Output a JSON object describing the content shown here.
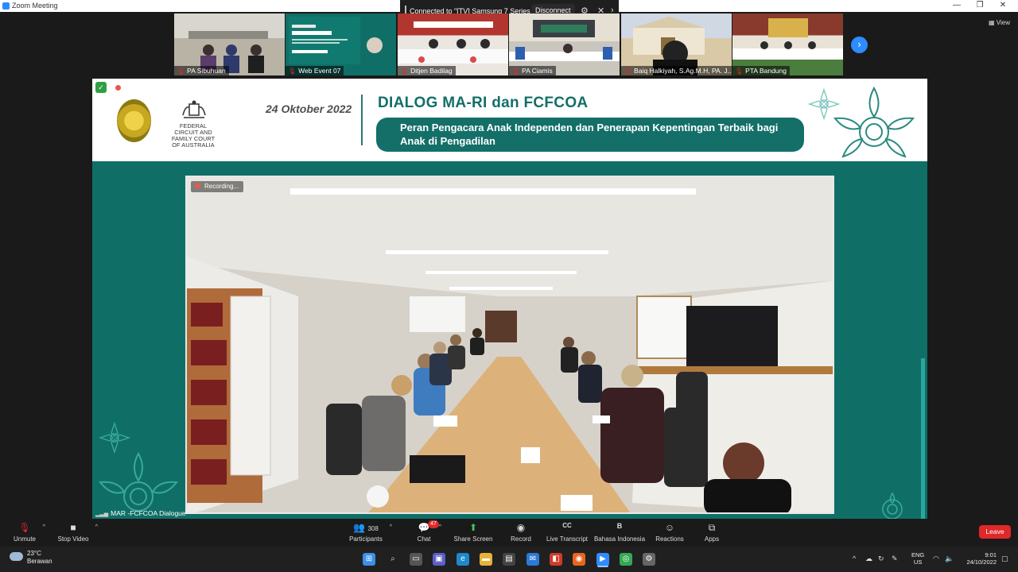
{
  "window": {
    "title": "Zoom Meeting",
    "minimize": "—",
    "restore": "❐",
    "close": "✕"
  },
  "connection": {
    "text": "Connected to \"[TV] Samsung 7 Series (58)\"",
    "disconnect_label": "Disconnect",
    "chevron": "›"
  },
  "view_label": "View",
  "participants_strip": [
    {
      "name": "PA Sibuhuan"
    },
    {
      "name": "Web Event 07"
    },
    {
      "name": "Ditjen Badilag"
    },
    {
      "name": "PA Ciamis"
    },
    {
      "name": "Baiq Halkiyah, S.Ag.M.H, PA. J..."
    },
    {
      "name": "PTA Bandung"
    }
  ],
  "next_arrow": "›",
  "slide": {
    "date": "24 Oktober 2022",
    "court_name": "FEDERAL CIRCUIT AND FAMILY COURT OF AUSTRALIA",
    "title": "DIALOG MA-RI dan FCFCOA",
    "subtitle": "Peran Pengacara Anak Independen dan Penerapan Kepentingan Terbaik bagi Anak di Pengadilan",
    "recording_label": "Recording..."
  },
  "speaker_name": "MAR -FCFCOA Dialogue",
  "toolbar": {
    "unmute": "Unmute",
    "stop_video": "Stop Video",
    "participants_label": "Participants",
    "participants_count": "308",
    "chat": "Chat",
    "chat_badge": "47",
    "share_screen": "Share Screen",
    "record": "Record",
    "live_transcript": "Live Transcript",
    "cc": "CC",
    "language": "Bahasa Indonesia",
    "language_icon": "B",
    "reactions": "Reactions",
    "apps": "Apps",
    "leave": "Leave"
  },
  "taskbar": {
    "temperature": "23°C",
    "weather": "Berawan",
    "lang": "ENG",
    "region": "US",
    "time": "9:01",
    "date": "24/10/2022"
  },
  "colors": {
    "teal": "#136f68",
    "zoom_blue": "#2d8cff",
    "leave_red": "#e02828",
    "share_green": "#43c560"
  }
}
